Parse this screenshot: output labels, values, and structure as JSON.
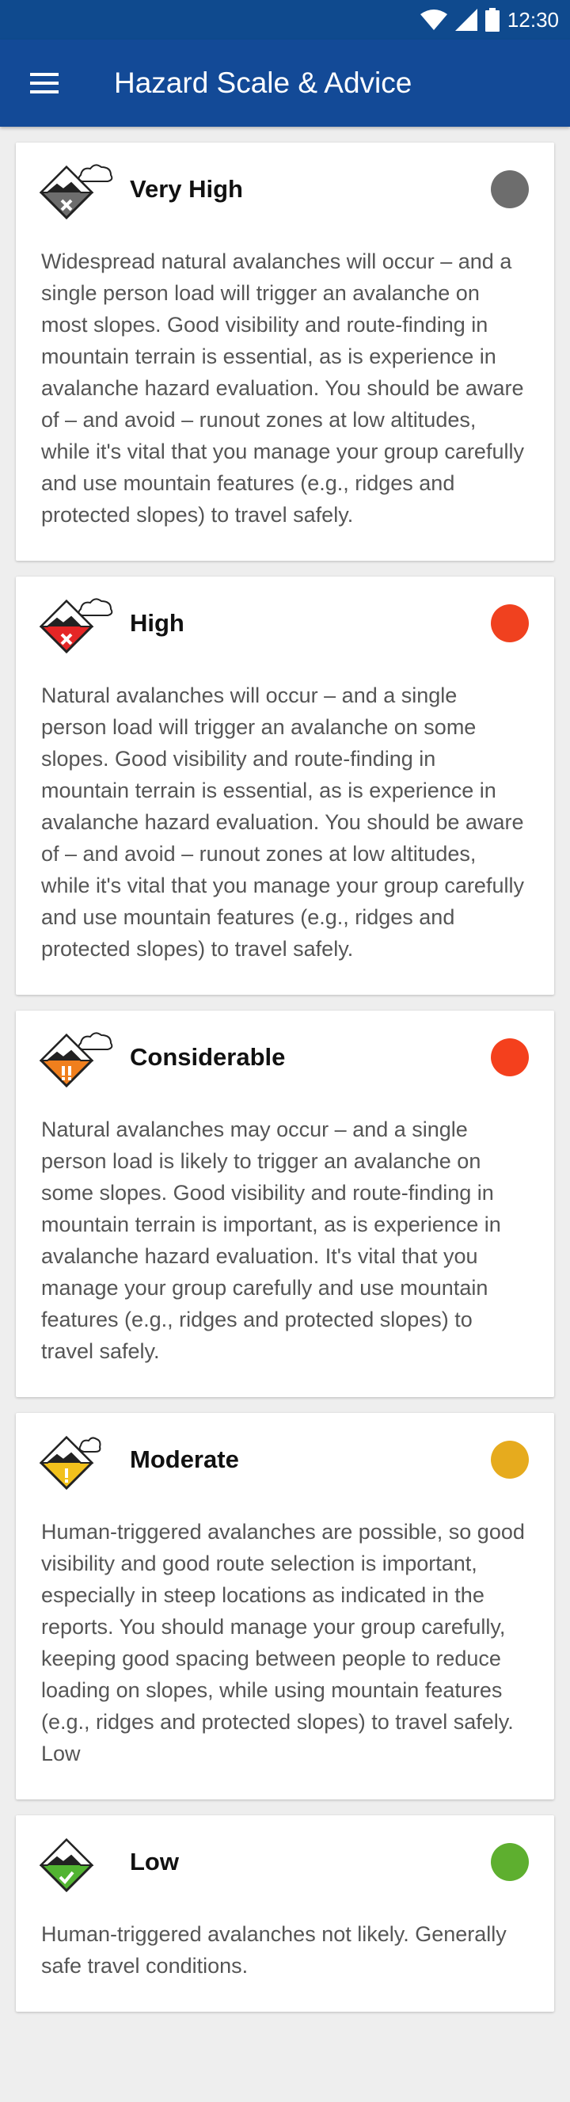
{
  "status_bar": {
    "time": "12:30"
  },
  "app_bar": {
    "title": "Hazard Scale & Advice"
  },
  "cards": [
    {
      "title": "Very High",
      "color": "#6d6d6d",
      "icon": "very-high-hazard-icon",
      "text": "Widespread natural avalanches will occur – and a single person load will trigger an avalanche on most slopes. Good visibility and route-finding in mountain terrain is essential, as is experience in avalanche hazard evaluation. You should be aware of – and avoid – runout zones at low altitudes, while it's vital that you manage your group carefully and use mountain features (e.g., ridges and protected slopes) to travel safely."
    },
    {
      "title": "High",
      "color": "#f0411f",
      "icon": "high-hazard-icon",
      "text": "Natural avalanches will occur – and a single person load will trigger an avalanche on some slopes. Good visibility and route-finding in mountain terrain is essential, as is experience in avalanche hazard evaluation. You should be aware of – and avoid – runout zones at low altitudes, while it's vital that you manage your group carefully and use mountain features (e.g., ridges and protected slopes) to travel safely."
    },
    {
      "title": "Considerable",
      "color": "#f4401d",
      "icon": "considerable-hazard-icon",
      "text": "Natural avalanches may occur – and a single person load is likely to trigger an avalanche on some slopes. Good visibility and route-finding in mountain terrain is important, as is experience in avalanche hazard evaluation. It's vital that you manage your group carefully and use mountain features (e.g., ridges and protected slopes) to travel safely."
    },
    {
      "title": "Moderate",
      "color": "#e6ab1e",
      "icon": "moderate-hazard-icon",
      "text": "Human-triggered avalanches are possible, so good visibility and good route selection is important, especially in steep locations as indicated in the reports. You should manage your group carefully, keeping good spacing between people to reduce loading on slopes, while using mountain features (e.g., ridges and protected slopes) to travel safely. Low"
    },
    {
      "title": "Low",
      "color": "#5eaf2f",
      "icon": "low-hazard-icon",
      "text": "Human-triggered avalanches not likely. Generally safe travel conditions."
    }
  ]
}
